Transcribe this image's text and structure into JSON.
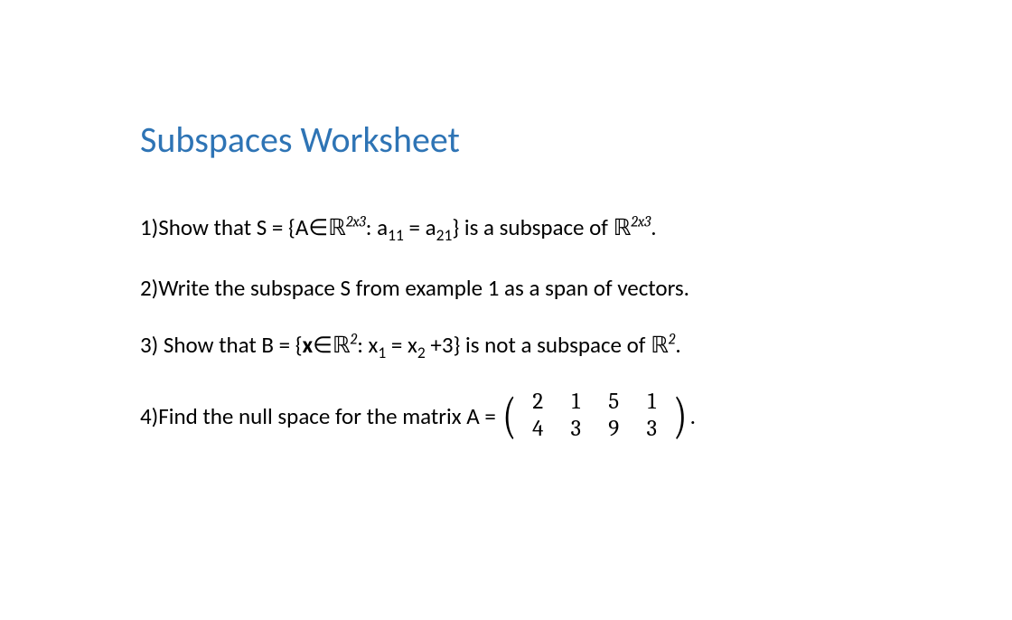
{
  "title": "Subspaces Worksheet",
  "problems": {
    "p1": {
      "num": "1)",
      "text1": "Show that S = {A",
      "eps": "∈",
      "R": "ℝ",
      "sup1": "2x3",
      "text2": ": a",
      "sub1": "11",
      "text3": " = a",
      "sub2": "21",
      "text4": "} is a subspace of ",
      "R2": "ℝ",
      "sup2": "2x3",
      "text5": "."
    },
    "p2": {
      "num": "2)",
      "text": "Write the subspace S from example 1 as a span of vectors."
    },
    "p3": {
      "num": "3)",
      "text1": " Show that B = {",
      "x": "x",
      "eps": "∈",
      "R": "ℝ",
      "sup1": "2",
      "text2": ": x",
      "sub1": "1",
      "text3": " = x",
      "sub2": "2",
      "text4": " +3} is not a subspace of ",
      "R2": "ℝ",
      "sup2": "2",
      "text5": "."
    },
    "p4": {
      "num": "4)",
      "text1": "Find the null space for the matrix A = ",
      "matrix": {
        "row1": [
          "2",
          "1",
          "5",
          "1"
        ],
        "row2": [
          "4",
          "3",
          "9",
          "3"
        ]
      },
      "text2": "."
    }
  },
  "chart_data": {
    "type": "table",
    "title": "Matrix A",
    "rows": [
      [
        2,
        1,
        5,
        1
      ],
      [
        4,
        3,
        9,
        3
      ]
    ]
  }
}
